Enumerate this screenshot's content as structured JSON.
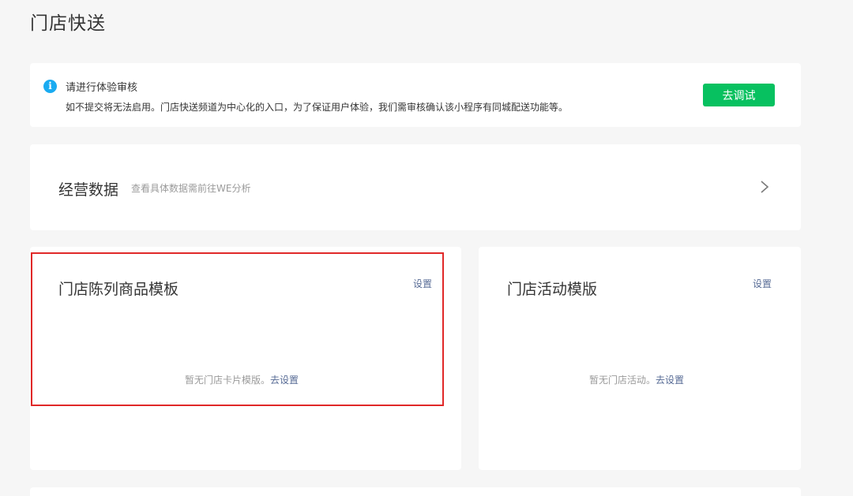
{
  "page": {
    "title": "门店快送"
  },
  "notice": {
    "title": "请进行体验审核",
    "description": "如不提交将无法启用。门店快送频道为中心化的入口，为了保证用户体验，我们需审核确认该小程序有同城配送功能等。",
    "button_label": "去调试",
    "icon": "info-icon",
    "icon_glyph": "i"
  },
  "operations": {
    "title": "经营数据",
    "subtitle": "查看具体数据需前往WE分析",
    "icon": "chevron-right-icon"
  },
  "templates": [
    {
      "title": "门店陈列商品模板",
      "setting_label": "设置",
      "empty_text": "暂无门店卡片模版。",
      "empty_link": "去设置"
    },
    {
      "title": "门店活动模版",
      "setting_label": "设置",
      "empty_text": "暂无门店活动。",
      "empty_link": "去设置"
    }
  ],
  "colors": {
    "accent_green": "#07c160",
    "link_blue": "#576b95",
    "info_blue": "#1aabf1",
    "highlight_red": "#e02828",
    "background": "#f6f6f6"
  }
}
